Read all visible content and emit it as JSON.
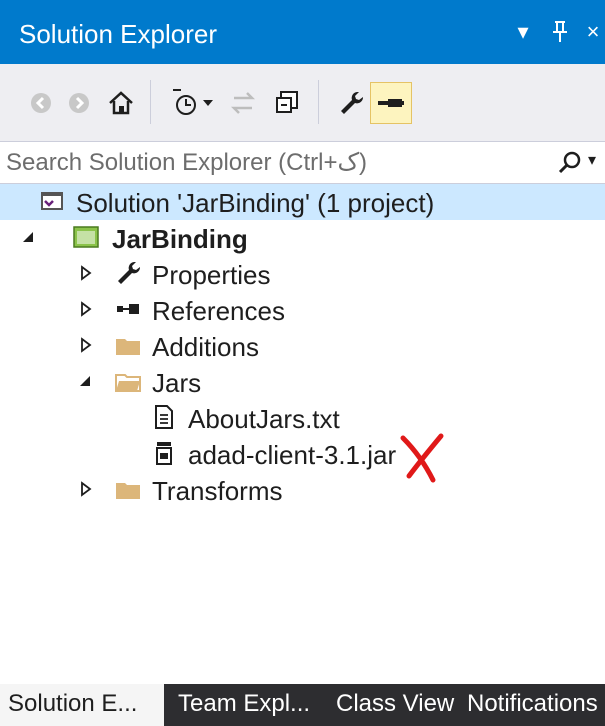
{
  "titlebar": {
    "title": "Solution Explorer",
    "dropdown_glyph": "▾",
    "pin_glyph": "⊥",
    "close_glyph": "×"
  },
  "toolbar": {
    "icons": [
      "back-icon",
      "forward-icon",
      "home-icon",
      "pending-changes-icon",
      "sync-icon",
      "collapse-all-icon",
      "properties-wrench-icon",
      "preview-selected-icon"
    ]
  },
  "search": {
    "placeholder": "Search Solution Explorer (Ctrl+ک)",
    "caret": "▾"
  },
  "tree": {
    "solution": "Solution 'JarBinding' (1 project)",
    "project": "JarBinding",
    "properties": "Properties",
    "references": "References",
    "additions": "Additions",
    "jars": "Jars",
    "about_jars": "AboutJars.txt",
    "jar_file": "adad-client-3.1.jar",
    "transforms": "Transforms"
  },
  "tabs": {
    "solution_explorer": "Solution E...",
    "team_explorer": "Team Expl...",
    "class_view": "Class View",
    "notifications": "Notifications"
  },
  "colors": {
    "title_bg": "#007acc",
    "toolbar_bg": "#eeeef2",
    "tab_bar_bg": "#2d2d30",
    "folder_yellow": "#dcb67a",
    "annotation_red": "#e01919"
  }
}
